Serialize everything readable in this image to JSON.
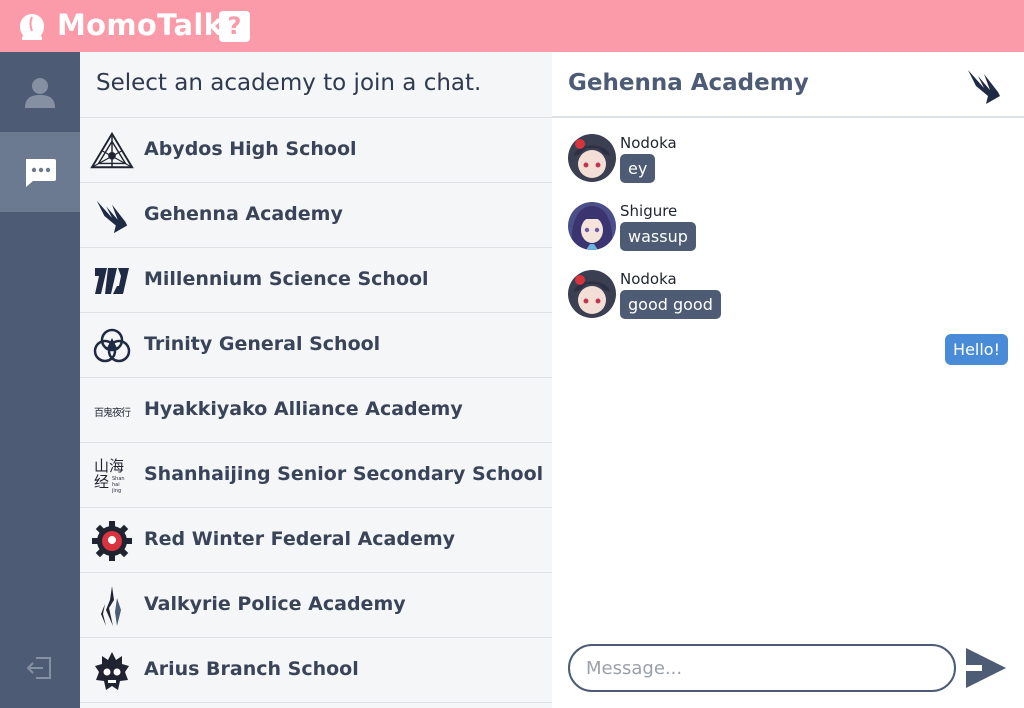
{
  "header": {
    "app_title": "MomoTalk",
    "help_label": "?",
    "colors": {
      "brand": "#fb9aa8",
      "sidebar": "#4d5b75",
      "sidebar_active": "#6c7a91",
      "own_bubble": "#4a8bd8"
    }
  },
  "sidebar": {
    "items": [
      {
        "name": "profile",
        "icon": "user-icon",
        "active": false
      },
      {
        "name": "chats",
        "icon": "chat-bubble-icon",
        "active": true
      },
      {
        "name": "logout",
        "icon": "logout-icon",
        "active": false
      }
    ]
  },
  "academy_list": {
    "title": "Select an academy to join a chat.",
    "academies": [
      {
        "name": "Abydos High School",
        "icon": "abydos-logo"
      },
      {
        "name": "Gehenna Academy",
        "icon": "gehenna-logo"
      },
      {
        "name": "Millennium Science School",
        "icon": "millennium-logo"
      },
      {
        "name": "Trinity General School",
        "icon": "trinity-logo"
      },
      {
        "name": "Hyakkiyako Alliance Academy",
        "icon": "hyakkiyako-logo"
      },
      {
        "name": "Shanhaijing Senior Secondary School",
        "icon": "shanhaijing-logo"
      },
      {
        "name": "Red Winter Federal Academy",
        "icon": "red-winter-logo"
      },
      {
        "name": "Valkyrie Police Academy",
        "icon": "valkyrie-logo"
      },
      {
        "name": "Arius Branch School",
        "icon": "arius-logo"
      }
    ],
    "logo_text": {
      "hyakkiyako": "百鬼夜行",
      "shanhaijing_main": "山海经",
      "shanhaijing_sub": "Shan hai jing"
    }
  },
  "chat": {
    "title": "Gehenna Academy",
    "header_icon": "gehenna-logo",
    "messages": [
      {
        "sender": "Nodoka",
        "text": "ey",
        "avatar": "nodoka-avatar"
      },
      {
        "sender": "Shigure",
        "text": "wassup",
        "avatar": "shigure-avatar"
      },
      {
        "sender": "Nodoka",
        "text": "good good",
        "avatar": "nodoka-avatar"
      }
    ],
    "own_message": {
      "text": "Hello!"
    },
    "input": {
      "placeholder": "Message...",
      "value": ""
    },
    "send_icon": "send-arrow-icon"
  }
}
